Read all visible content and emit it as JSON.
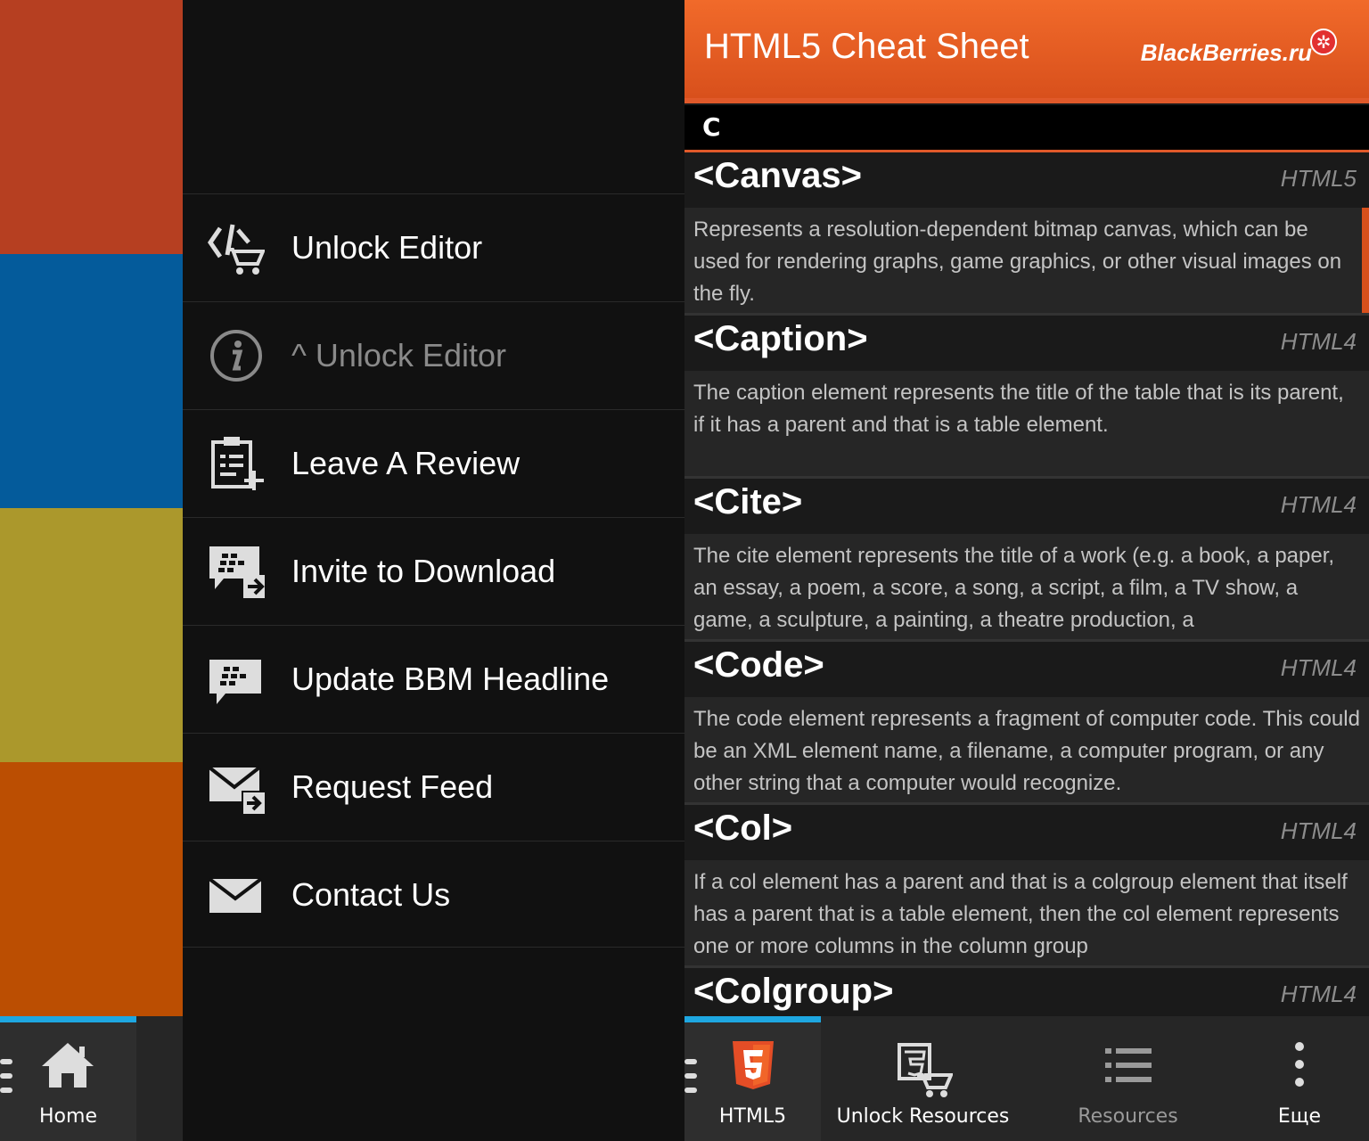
{
  "colors": {
    "tile_red": "#b63f21",
    "tile_blue": "#045b9b",
    "tile_olive": "#ab982c",
    "tile_orange": "#bb4e02",
    "accent_orange": "#e0592a",
    "accent_blue": "#1ea7e1"
  },
  "left_bar": {
    "home_label": "Home"
  },
  "menu": {
    "items": [
      {
        "label": "Unlock Editor",
        "icon": "code-cart-icon",
        "disabled": false
      },
      {
        "label": "^ Unlock Editor",
        "icon": "info-icon",
        "disabled": true
      },
      {
        "label": "Leave A Review",
        "icon": "clipboard-add-icon",
        "disabled": false
      },
      {
        "label": "Invite to Download",
        "icon": "bbm-share-icon",
        "disabled": false
      },
      {
        "label": "Update BBM Headline",
        "icon": "bbm-icon",
        "disabled": false
      },
      {
        "label": "Request Feed",
        "icon": "mail-forward-icon",
        "disabled": false
      },
      {
        "label": "Contact Us",
        "icon": "mail-icon",
        "disabled": false
      }
    ]
  },
  "content": {
    "title": "HTML5 Cheat Sheet",
    "brand": "BlackBerries.ru",
    "section_letter": "C",
    "entries": [
      {
        "tag": "<Canvas>",
        "version": "HTML5",
        "description": "Represents a resolution-dependent bitmap canvas, which can be used for rendering graphs, game graphics, or other visual images on the fly."
      },
      {
        "tag": "<Caption>",
        "version": "HTML4",
        "description": "The caption element represents the title of the table that is its parent, if it has a parent and that is a table element."
      },
      {
        "tag": "<Cite>",
        "version": "HTML4",
        "description": "The cite element represents the title of a work (e.g. a book, a paper, an essay, a poem, a score, a song, a script, a film, a TV show, a game, a sculpture, a painting, a theatre production, a"
      },
      {
        "tag": "<Code>",
        "version": "HTML4",
        "description": "The code element represents a fragment of computer code. This could be an XML element name, a filename, a computer program, or any other string that a computer would recognize."
      },
      {
        "tag": "<Col>",
        "version": "HTML4",
        "description": "If a col element has a parent and that is a colgroup element that itself has a parent that is a table element, then the col element represents one or more columns in the column group"
      },
      {
        "tag": "<Colgroup>",
        "version": "HTML4",
        "description": ""
      }
    ]
  },
  "right_bar": {
    "actions": [
      {
        "label": "HTML5",
        "icon": "html5-icon"
      },
      {
        "label": "Unlock Resources",
        "icon": "code-cart-icon"
      },
      {
        "label": "Resources",
        "icon": "list-icon"
      },
      {
        "label": "Еще",
        "icon": "more-vertical-icon"
      }
    ]
  }
}
